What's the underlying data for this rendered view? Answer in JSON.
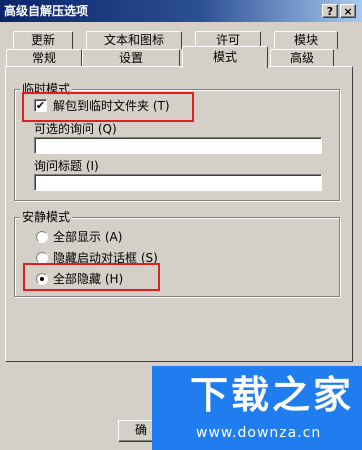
{
  "window": {
    "title": "高级自解压选项",
    "help_button": "?",
    "close_button": "×"
  },
  "tabs": {
    "row_back": [
      "更新",
      "文本和图标",
      "许可",
      "模块"
    ],
    "row_front": [
      "常规",
      "设置",
      "模式",
      "高级"
    ],
    "active": "模式"
  },
  "temp_mode": {
    "group_title": "临时模式",
    "unpack_temp_checkbox": {
      "label": "解包到临时文件夹 (T)",
      "checked": true,
      "check_glyph": "✔"
    },
    "optional_question_label": "可选的询问 (Q)",
    "optional_question_value": "",
    "question_title_label": "询问标题 (I)",
    "question_title_value": ""
  },
  "silent_mode": {
    "group_title": "安静模式",
    "options": [
      {
        "label": "全部显示 (A)",
        "selected": false
      },
      {
        "label": "隐藏启动对话框 (S)",
        "selected": false
      },
      {
        "label": "全部隐藏 (H)",
        "selected": true
      }
    ]
  },
  "footer": {
    "ok_button_visible_label": "确"
  },
  "watermark": {
    "title": "下载之家",
    "url": "www.downza.cn"
  },
  "colors": {
    "titlebar_start": "#0a246a",
    "titlebar_end": "#a6caf0",
    "dialog_bg": "#d4d0c8",
    "highlight": "#e02020",
    "watermark_bg": "#1f7df0"
  }
}
